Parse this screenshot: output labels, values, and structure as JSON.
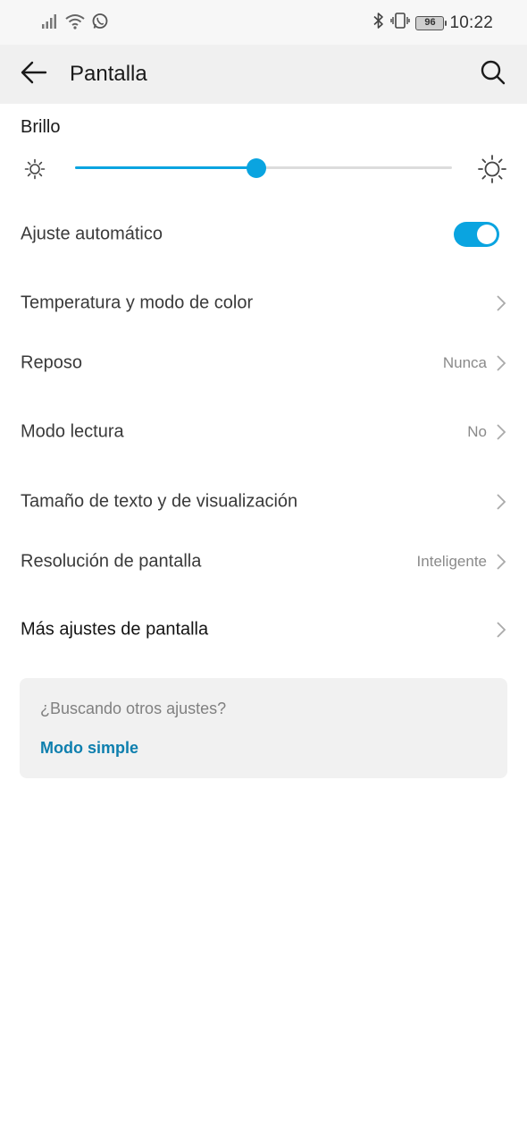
{
  "status_bar": {
    "time": "10:22",
    "battery": "96",
    "icons": [
      "signal-icon",
      "wifi-icon",
      "whatsapp-icon",
      "bluetooth-icon",
      "vibrate-icon",
      "battery-icon"
    ]
  },
  "header": {
    "title": "Pantalla",
    "back_icon": "arrow-left-icon",
    "search_icon": "search-icon"
  },
  "brightness": {
    "label": "Brillo",
    "level": 0.48,
    "accent_color": "#0aa4e0"
  },
  "settings": {
    "auto_adjust": {
      "label": "Ajuste automático",
      "enabled": true
    },
    "color_temp": {
      "label": "Temperatura y modo de color"
    },
    "sleep": {
      "label": "Reposo",
      "value": "Nunca"
    },
    "reading_mode": {
      "label": "Modo lectura",
      "value": "No"
    },
    "text_size": {
      "label": "Tamaño de texto y de visualización"
    },
    "resolution": {
      "label": "Resolución de pantalla",
      "value": "Inteligente"
    },
    "more_settings": {
      "label": "Más ajustes de pantalla"
    }
  },
  "suggestion": {
    "question": "¿Buscando otros ajustes?",
    "link": "Modo simple",
    "link_color": "#0e7fae"
  }
}
